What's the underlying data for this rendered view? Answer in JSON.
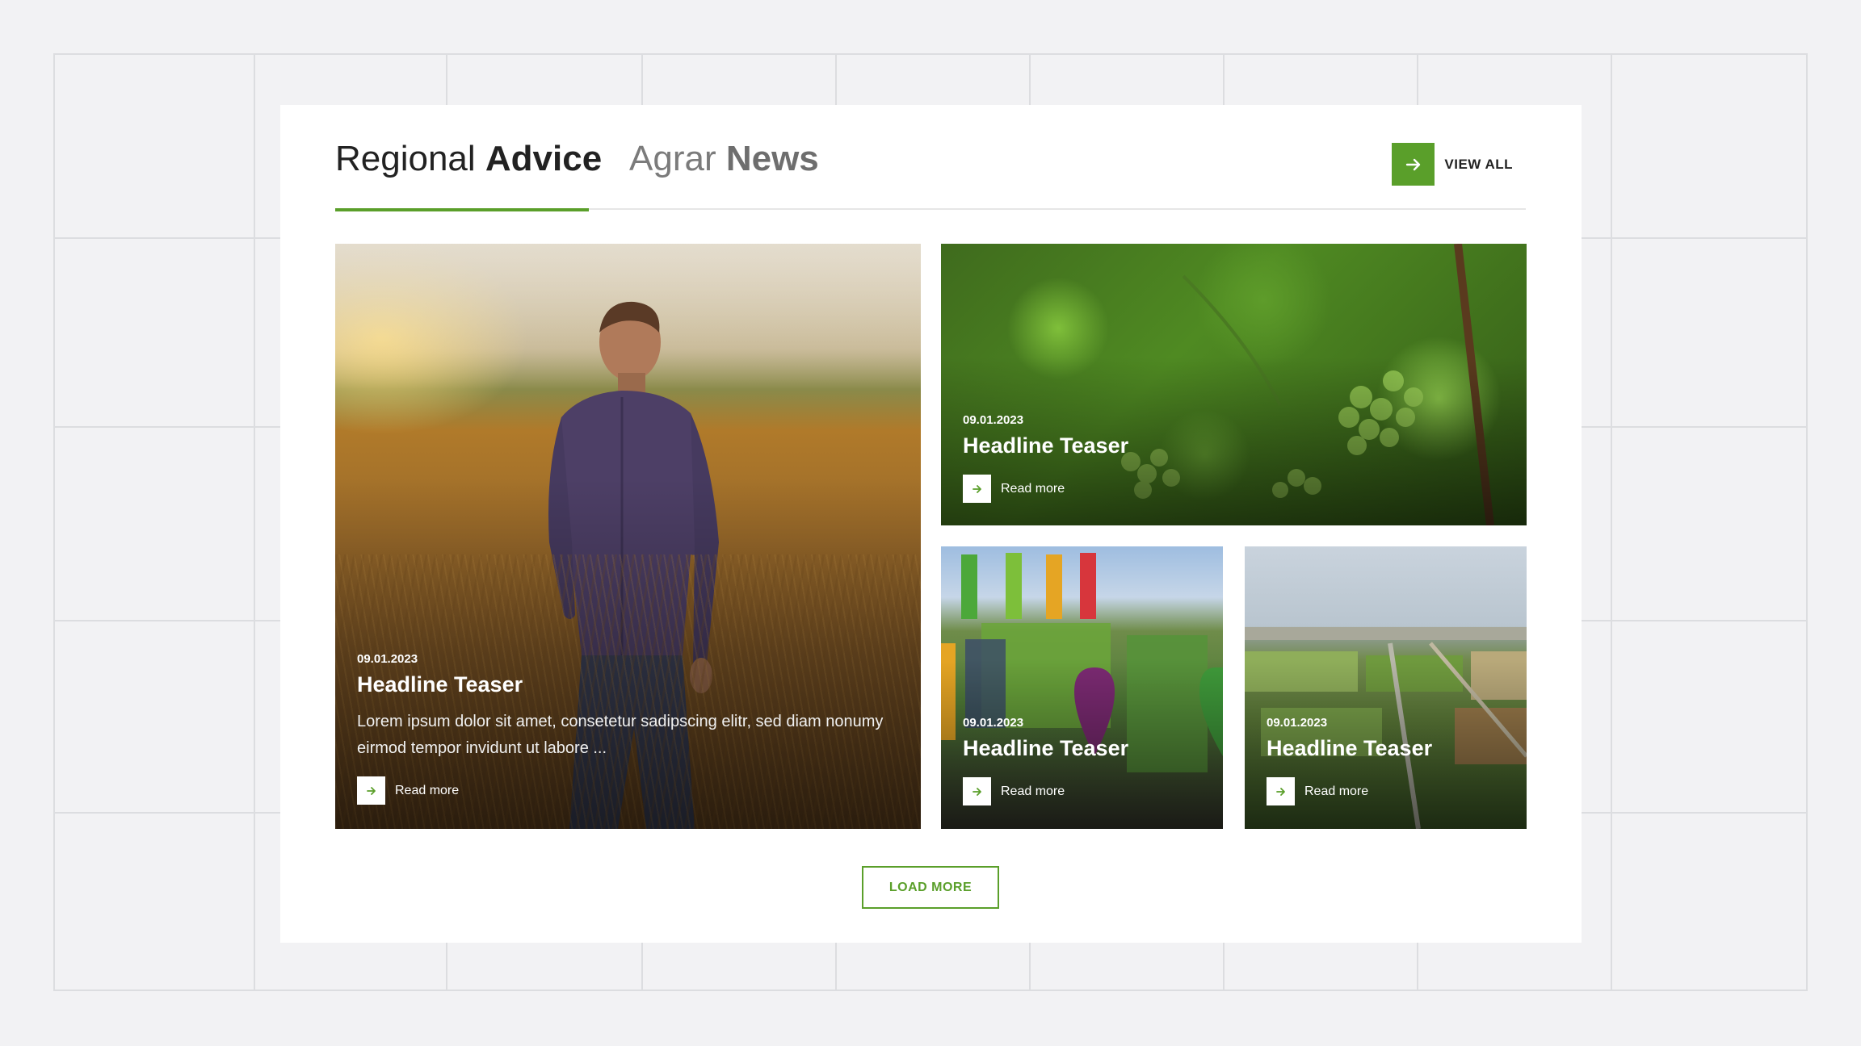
{
  "tabs": [
    {
      "light": "Regional ",
      "bold": "Advice",
      "active": true
    },
    {
      "light": "Agrar ",
      "bold": "News",
      "active": false
    }
  ],
  "header": {
    "view_all_label": "VIEW ALL",
    "view_all_icon": "arrow-right-icon"
  },
  "cards": [
    {
      "date": "09.01.2023",
      "title": "Headline Teaser",
      "excerpt": "Lorem ipsum dolor sit amet, consetetur sadipscing elitr, sed diam nonumy eirmod tempor invidunt ut labore ...",
      "read_more": "Read more",
      "image": "farmer-in-wheat-field"
    },
    {
      "date": "09.01.2023",
      "title": "Headline Teaser",
      "read_more": "Read more",
      "image": "grape-vine-leaves"
    },
    {
      "date": "09.01.2023",
      "title": "Headline Teaser",
      "read_more": "Read more",
      "image": "basf-exhibition-stand"
    },
    {
      "date": "09.01.2023",
      "title": "Headline Teaser",
      "read_more": "Read more",
      "image": "aerial-farmland"
    }
  ],
  "load_more_label": "LOAD MORE",
  "colors": {
    "accent": "#5a9f2a",
    "background": "#f2f2f4",
    "panel": "#ffffff",
    "text": "#222222"
  }
}
